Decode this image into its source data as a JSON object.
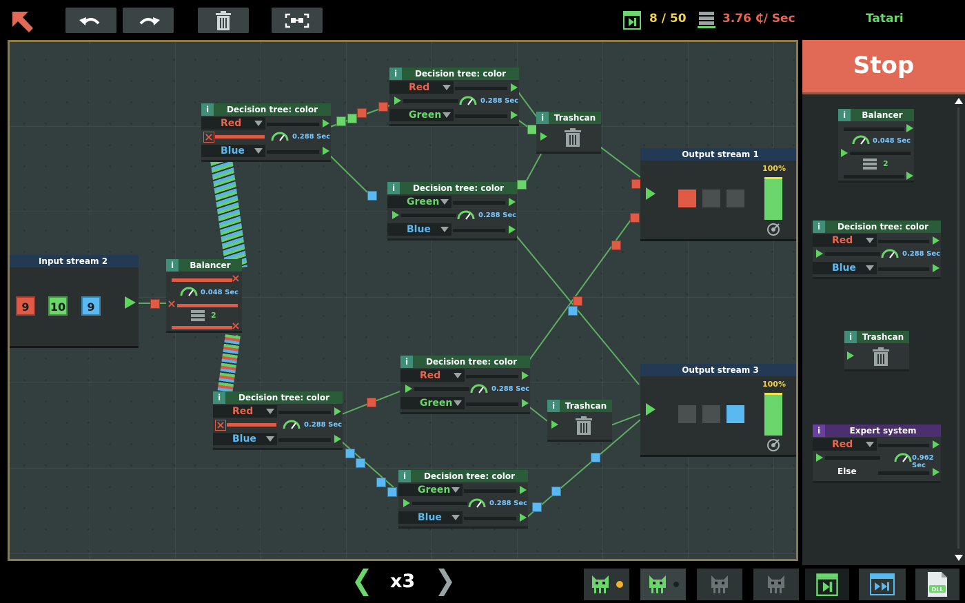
{
  "toolbar": {
    "programs": "8 / 50",
    "rate": "3.76 ₵/ Sec",
    "player": "Tatari"
  },
  "colors": {
    "red": "#e05a45",
    "green": "#6bd66b",
    "blue": "#5ab9f0",
    "accent": "#e06a55",
    "gold": "#f1d24a"
  },
  "nodes": {
    "dt_top": {
      "title": "Decision tree: color",
      "out1": "Red",
      "out2": "Green",
      "speed": "0.288 Sec"
    },
    "dt_left": {
      "title": "Decision tree: color",
      "out1": "Red",
      "out2": "Blue",
      "speed": "0.288 Sec"
    },
    "trash_top": {
      "title": "Trashcan"
    },
    "dt_mid": {
      "title": "Decision tree: color",
      "out1": "Green",
      "out2": "Blue",
      "speed": "0.288 Sec"
    },
    "out1": {
      "title": "Output stream 1",
      "percent": "100%",
      "fill": 1.0
    },
    "input2": {
      "title": "Input stream 2",
      "red": "9",
      "green": "10",
      "blue": "9"
    },
    "balancer": {
      "title": "Balancer",
      "speed": "0.048 Sec",
      "count": "2"
    },
    "dt_bl": {
      "title": "Decision tree: color",
      "out1": "Red",
      "out2": "Blue",
      "speed": "0.288 Sec"
    },
    "dt_br": {
      "title": "Decision tree: color",
      "out1": "Red",
      "out2": "Green",
      "speed": "0.288 Sec"
    },
    "trash_bot": {
      "title": "Trashcan"
    },
    "out3": {
      "title": "Output stream 3",
      "percent": "100%",
      "fill": 1.0
    },
    "dt_bottom": {
      "title": "Decision tree: color",
      "out1": "Green",
      "out2": "Blue",
      "speed": "0.288 Sec"
    }
  },
  "palette": {
    "balancer": {
      "title": "Balancer",
      "speed": "0.048 Sec",
      "count": "2"
    },
    "decision": {
      "title": "Decision tree: color",
      "out1": "Red",
      "out2": "Blue",
      "speed": "0.288 Sec"
    },
    "trashcan": {
      "title": "Trashcan"
    },
    "expert": {
      "title": "Expert system",
      "out1": "Red",
      "out2": "Else",
      "speed": "0.962 Sec"
    }
  },
  "controls": {
    "stop": "Stop",
    "speed": "x3"
  }
}
